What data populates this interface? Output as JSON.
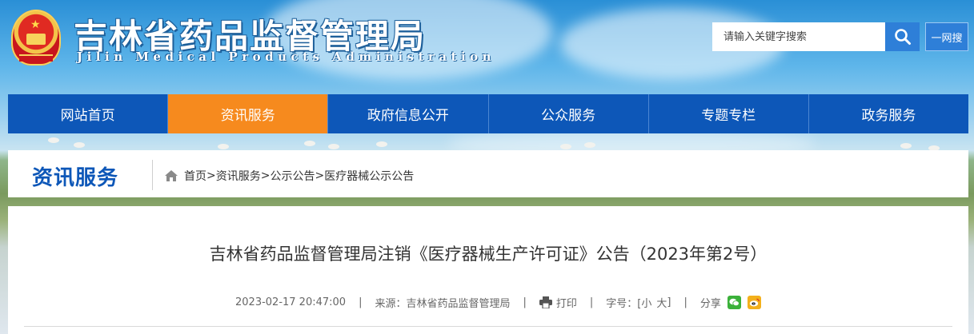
{
  "header": {
    "title": "吉林省药品监督管理局",
    "subtitle": "Jilin Medical Products Administration",
    "search_placeholder": "请输入关键字搜索",
    "search_icon": "search-icon",
    "net_search_label": "一网搜"
  },
  "nav": {
    "items": [
      {
        "label": "网站首页"
      },
      {
        "label": "资讯服务"
      },
      {
        "label": "政府信息公开"
      },
      {
        "label": "公众服务"
      },
      {
        "label": "专题专栏"
      },
      {
        "label": "政务服务"
      }
    ],
    "active_index": 1
  },
  "breadcrumb": {
    "section_title": "资讯服务",
    "items": [
      "首页",
      "资讯服务",
      "公示公告",
      "医疗器械公示公告"
    ],
    "separator": ">"
  },
  "article": {
    "title": "吉林省药品监督管理局注销《医疗器械生产许可证》公告（2023年第2号）",
    "datetime": "2023-02-17 20:47:00",
    "source_label": "来源：",
    "source": "吉林省药品监督管理局",
    "print_label": "打印",
    "font_size_label": "字号：[",
    "font_small": "小",
    "font_large": "大",
    "font_close": "]",
    "share_label": "分享",
    "divider": "|"
  },
  "colors": {
    "nav_bg": "#0d57b8",
    "nav_active": "#f68a1e",
    "search_btn": "#2e7fd8",
    "section_title": "#0d57b8"
  }
}
